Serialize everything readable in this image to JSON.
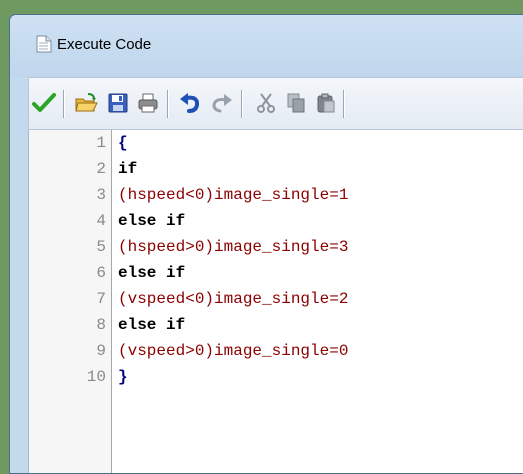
{
  "window": {
    "title": "Execute Code",
    "title_icon": "document-icon"
  },
  "toolbar": {
    "buttons": [
      {
        "name": "ok-button",
        "icon": "checkmark-icon",
        "enabled": true
      },
      {
        "name": "open-button",
        "icon": "open-folder-icon",
        "enabled": true
      },
      {
        "name": "save-button",
        "icon": "floppy-disk-icon",
        "enabled": true
      },
      {
        "name": "print-button",
        "icon": "printer-icon",
        "enabled": true
      },
      {
        "name": "undo-button",
        "icon": "undo-icon",
        "enabled": true
      },
      {
        "name": "redo-button",
        "icon": "redo-icon",
        "enabled": false
      },
      {
        "name": "cut-button",
        "icon": "scissors-icon",
        "enabled": false
      },
      {
        "name": "copy-button",
        "icon": "copy-icon",
        "enabled": false
      },
      {
        "name": "paste-button",
        "icon": "paste-icon",
        "enabled": false
      }
    ]
  },
  "editor": {
    "lines": [
      {
        "num": "1",
        "a": "{",
        "b": ""
      },
      {
        "num": "2",
        "a": "if",
        "b": ""
      },
      {
        "num": "3",
        "a": "(hspeed<0)",
        "b": "image_single=1"
      },
      {
        "num": "4",
        "a": "else if",
        "b": ""
      },
      {
        "num": "5",
        "a": "(hspeed>0)",
        "b": "image_single=3"
      },
      {
        "num": "6",
        "a": "else if",
        "b": ""
      },
      {
        "num": "7",
        "a": "(vspeed<0)",
        "b": "image_single=2"
      },
      {
        "num": "8",
        "a": "else if",
        "b": ""
      },
      {
        "num": "9",
        "a": "(vspeed>0)",
        "b": "image_single=0"
      },
      {
        "num": "10",
        "a": "}",
        "b": ""
      }
    ]
  },
  "colors": {
    "keyword": "#000000",
    "punctuation": "#000080",
    "expression": "#8b0000",
    "line_number": "#8a8a8a",
    "ok_green": "#2aa52a",
    "titlebar": "#c3d9ee"
  }
}
